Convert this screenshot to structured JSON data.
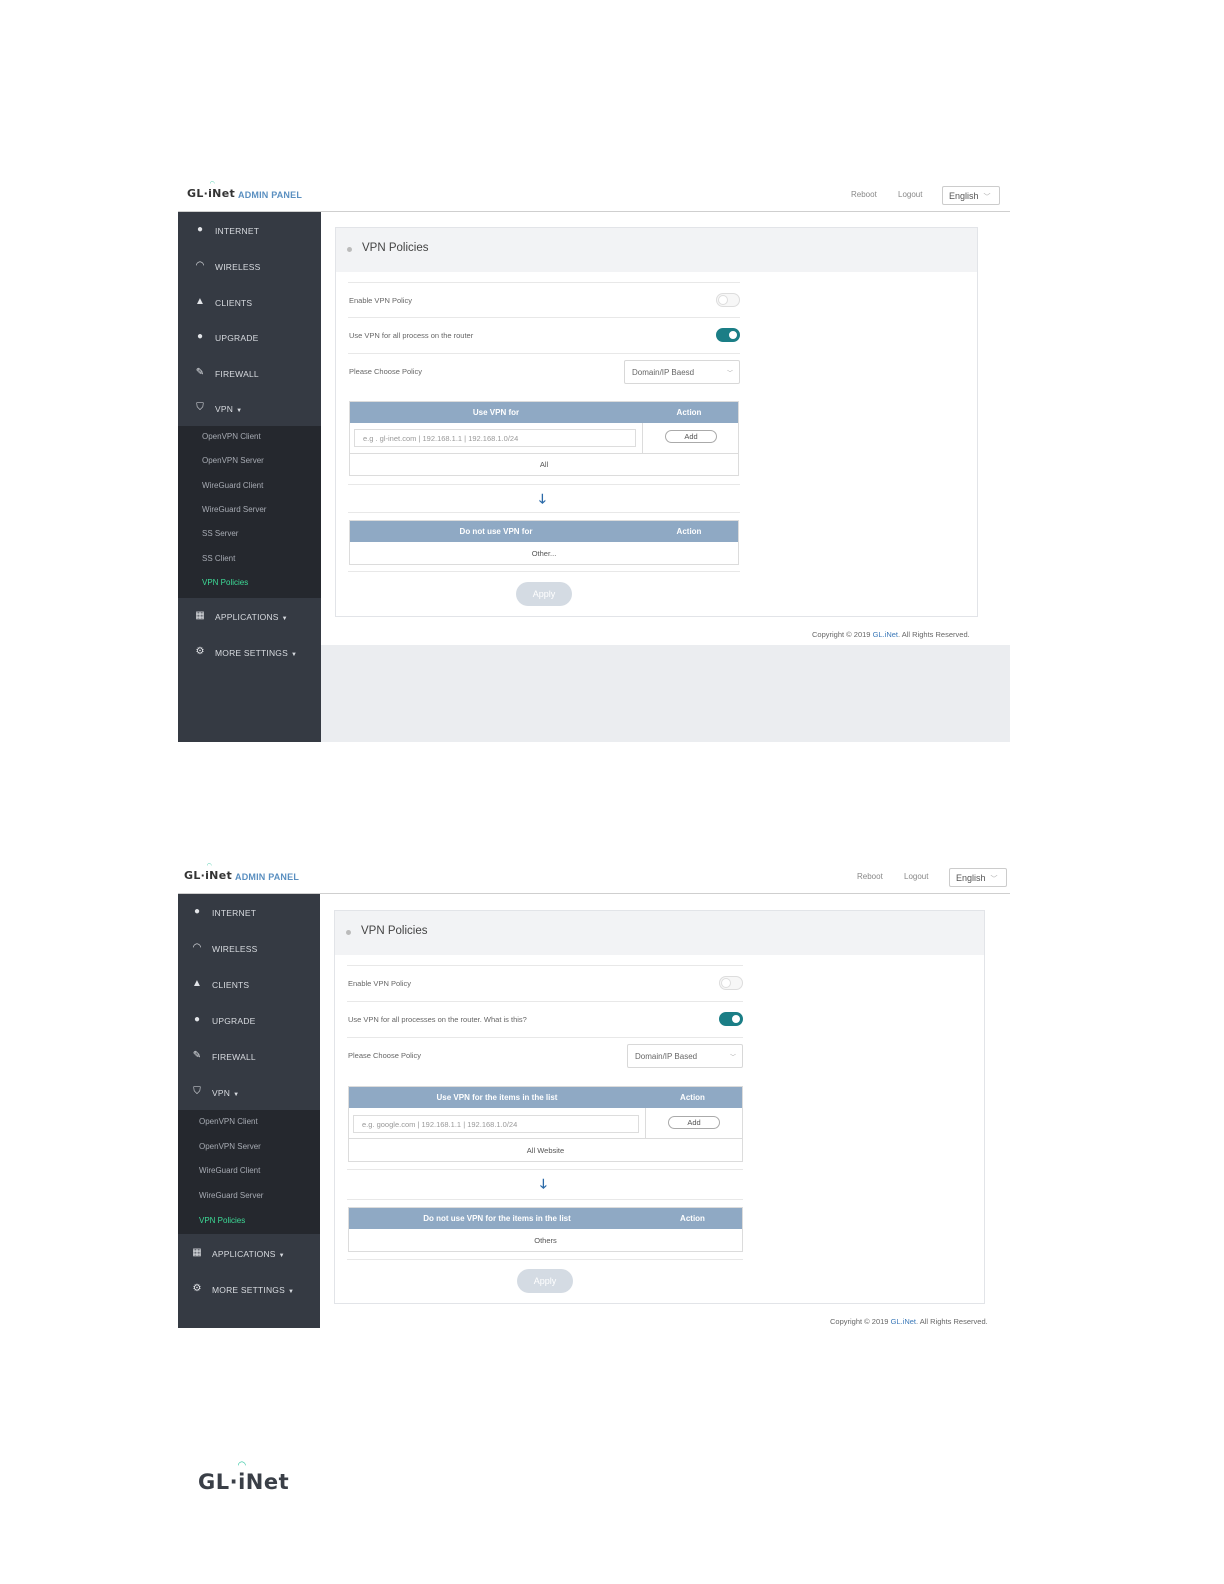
{
  "shot1": {
    "logo": "GL·iNet",
    "admin_panel": "ADMIN PANEL",
    "reboot": "Reboot",
    "logout": "Logout",
    "language": "English",
    "nav": {
      "internet": "INTERNET",
      "wireless": "WIRELESS",
      "clients": "CLIENTS",
      "upgrade": "UPGRADE",
      "firewall": "FIREWALL",
      "vpn": "VPN",
      "applications": "APPLICATIONS",
      "more_settings": "MORE SETTINGS"
    },
    "vpn_submenu": [
      "OpenVPN Client",
      "OpenVPN Server",
      "WireGuard Client",
      "WireGuard Server",
      "SS Server",
      "SS Client",
      "VPN Policies"
    ],
    "page_title": "VPN Policies",
    "enable_vpn_policy": "Enable VPN Policy",
    "use_vpn_all": "Use VPN for all process on the router",
    "choose_policy": "Please Choose Policy",
    "policy_value": "Domain/IP Baesd",
    "use_table_header": "Use VPN for",
    "action_header": "Action",
    "input_placeholder": "e.g . gl-inet.com | 192.168.1.1 | 192.168.1.0/24",
    "add_label": "Add",
    "use_all": "All",
    "not_use_table_header": "Do not use VPN for",
    "not_use_cell": "Other...",
    "apply_label": "Apply",
    "copyright_prefix": "Copyright © 2019 ",
    "copyright_brand": "GL.iNet",
    "copyright_suffix": ". All Rights Reserved."
  },
  "shot2": {
    "logo": "GL·iNet",
    "admin_panel": "ADMIN PANEL",
    "reboot": "Reboot",
    "logout": "Logout",
    "language": "English",
    "nav": {
      "internet": "INTERNET",
      "wireless": "WIRELESS",
      "clients": "CLIENTS",
      "upgrade": "UPGRADE",
      "firewall": "FIREWALL",
      "vpn": "VPN",
      "applications": "APPLICATIONS",
      "more_settings": "MORE SETTINGS"
    },
    "vpn_submenu": [
      "OpenVPN Client",
      "OpenVPN Server",
      "WireGuard Client",
      "WireGuard Server",
      "VPN Policies"
    ],
    "page_title": "VPN Policies",
    "enable_vpn_policy": "Enable VPN Policy",
    "use_vpn_all": "Use VPN for all processes on the router. What is this?",
    "choose_policy": "Please Choose Policy",
    "policy_value": "Domain/IP Based",
    "use_table_header": "Use VPN for the items in the list",
    "action_header": "Action",
    "input_placeholder": "e.g. google.com | 192.168.1.1 | 192.168.1.0/24",
    "add_label": "Add",
    "use_all": "All Website",
    "not_use_table_header": "Do not use VPN for the items in the list",
    "not_use_cell": "Others",
    "apply_label": "Apply",
    "copyright_prefix": "Copyright © 2019 ",
    "copyright_brand": "GL.iNet",
    "copyright_suffix": ". All Rights Reserved."
  },
  "footer_logo": "GL·iNet",
  "colors": {
    "sidebar": "#353a43",
    "submenu": "#25282e",
    "active": "#3ddc97",
    "toggle_on": "#1b7e86",
    "table_header": "#8fa9c4",
    "accent": "#5a8fc0"
  },
  "icons": [
    "globe-icon",
    "wifi-icon",
    "user-icon",
    "upgrade-icon",
    "firewall-icon",
    "shield-icon",
    "grid-icon",
    "gear-icon",
    "arrow-down-icon"
  ]
}
